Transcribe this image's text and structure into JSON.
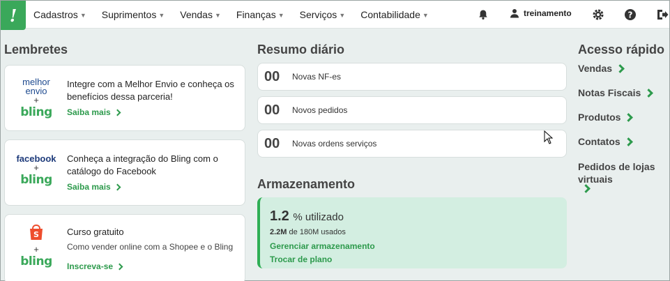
{
  "nav": {
    "logo_glyph": "!",
    "items": [
      {
        "label": "Cadastros"
      },
      {
        "label": "Suprimentos"
      },
      {
        "label": "Vendas"
      },
      {
        "label": "Finanças"
      },
      {
        "label": "Serviços"
      },
      {
        "label": "Contabilidade"
      }
    ],
    "user": "treinamento",
    "icons": [
      "bell-icon",
      "user-icon",
      "gear-icon",
      "help-icon",
      "logout-icon"
    ]
  },
  "reminders": {
    "title": "Lembretes",
    "cards": [
      {
        "brand_top": "melhor envio",
        "plus": "+",
        "brand_bottom": "bling",
        "text": "Integre com a Melhor Envio e conheça os benefícios dessa parceria!",
        "link": "Saiba mais"
      },
      {
        "brand_top": "facebook",
        "plus": "+",
        "brand_bottom": "bling",
        "text": "Conheça a integração do Bling com o catálogo do Facebook",
        "link": "Saiba mais"
      },
      {
        "brand_top": "shopee",
        "plus": "+",
        "brand_bottom": "bling",
        "title": "Curso gratuito",
        "text": "Como vender online com a Shopee e o Bling",
        "link": "Inscreva-se"
      }
    ]
  },
  "summary": {
    "title": "Resumo diário",
    "rows": [
      {
        "count": "00",
        "label": "Novas NF-es"
      },
      {
        "count": "00",
        "label": "Novos pedidos"
      },
      {
        "count": "00",
        "label": "Novas ordens serviços"
      }
    ]
  },
  "storage": {
    "title": "Armazenamento",
    "percent": "1.2",
    "percent_suffix": "% utilizado",
    "used": "2.2M",
    "used_suffix": "de 180M usados",
    "manage_link": "Gerenciar armazenamento",
    "plan_link": "Trocar de plano"
  },
  "quick_access": {
    "title": "Acesso rápido",
    "items": [
      {
        "label": "Vendas"
      },
      {
        "label": "Notas Fiscais"
      },
      {
        "label": "Produtos"
      },
      {
        "label": "Contatos"
      },
      {
        "label": "Pedidos de lojas virtuais"
      }
    ]
  },
  "colors": {
    "accent": "#3aa85a",
    "storage_bg": "#d3eee1",
    "page_bg": "#e9efee"
  }
}
